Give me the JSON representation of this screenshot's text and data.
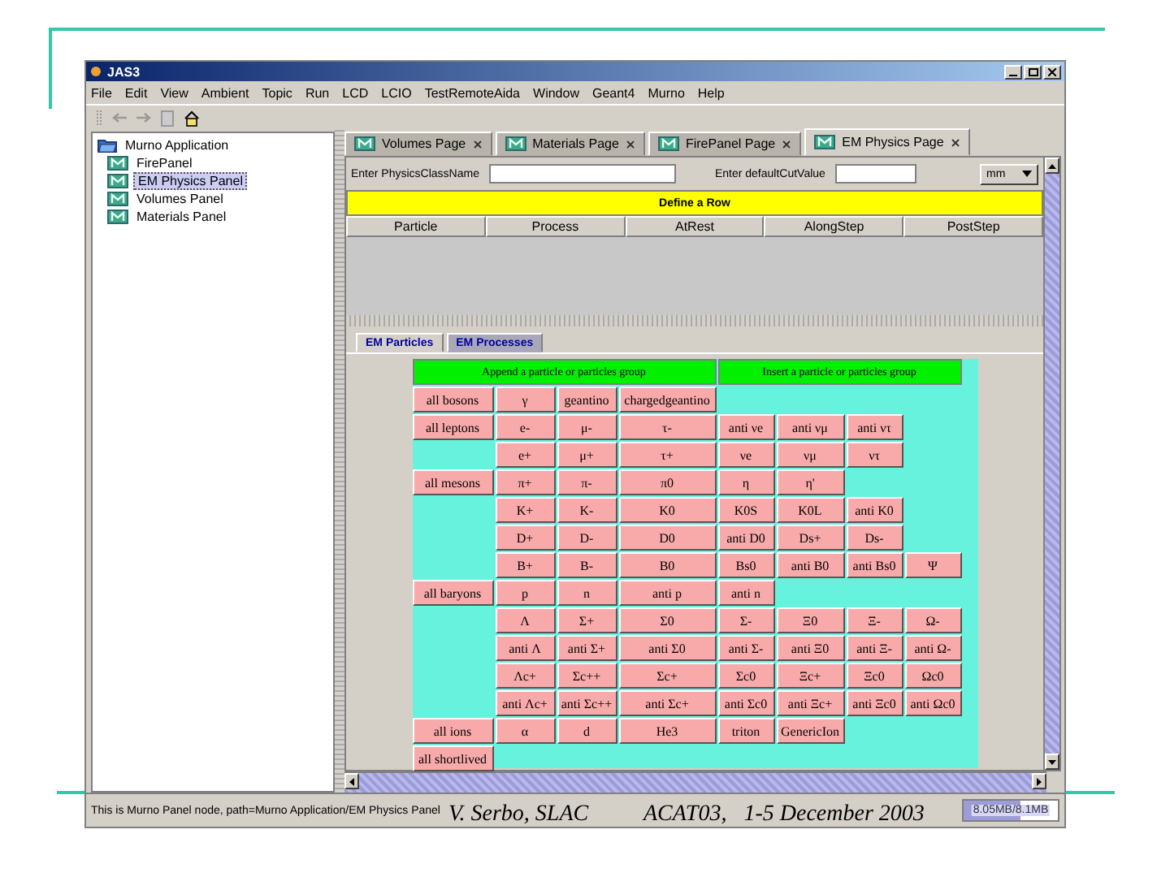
{
  "window": {
    "title": "JAS3"
  },
  "menu": [
    "File",
    "Edit",
    "View",
    "Ambient",
    "Topic",
    "Run",
    "LCD",
    "LCIO",
    "TestRemoteAida",
    "Window",
    "Geant4",
    "Murno",
    "Help"
  ],
  "tree": {
    "label": "Murno Application",
    "expanded": true,
    "children": [
      {
        "label": "FirePanel",
        "selected": false
      },
      {
        "label": "EM Physics Panel",
        "selected": true
      },
      {
        "label": "Volumes Panel",
        "selected": false
      },
      {
        "label": "Materials Panel",
        "selected": false
      }
    ]
  },
  "tabs": [
    {
      "label": "Volumes Page",
      "selected": false
    },
    {
      "label": "Materials Page",
      "selected": false
    },
    {
      "label": "FirePanel Page",
      "selected": false
    },
    {
      "label": "EM Physics Page",
      "selected": true
    }
  ],
  "form": {
    "class_label": "Enter PhysicsClassName",
    "cut_label": "Enter defaultCutValue",
    "unit": "mm"
  },
  "define_bar": "Define a Row",
  "columns": [
    "Particle",
    "Process",
    "AtRest",
    "AlongStep",
    "PostStep"
  ],
  "subtabs": [
    {
      "label": "EM Particles",
      "selected": true
    },
    {
      "label": "EM Processes",
      "selected": false
    }
  ],
  "actions": [
    "Append a particle or particles group",
    "Insert a particle or particles group"
  ],
  "particle_rows": [
    {
      "group": "all bosons",
      "cells": [
        "γ",
        "geantino",
        "chargedgeantino"
      ]
    },
    {
      "group": "all leptons",
      "cells": [
        "e-",
        "μ-",
        "τ-",
        "anti νe",
        "anti νμ",
        "anti ντ"
      ]
    },
    {
      "cells": [
        "e+",
        "μ+",
        "τ+",
        "νe",
        "νμ",
        "ντ"
      ]
    },
    {
      "group": "all mesons",
      "cells": [
        "π+",
        "π-",
        "π0",
        "η",
        "η'"
      ]
    },
    {
      "cells": [
        "K+",
        "K-",
        "K0",
        "K0S",
        "K0L",
        "anti K0"
      ]
    },
    {
      "cells": [
        "D+",
        "D-",
        "D0",
        "anti D0",
        "Ds+",
        "Ds-"
      ]
    },
    {
      "cells": [
        "B+",
        "B-",
        "B0",
        "Bs0",
        "anti B0",
        "anti Bs0",
        "Ψ"
      ]
    },
    {
      "group": "all baryons",
      "cells": [
        "p",
        "n",
        "anti p",
        "anti n"
      ]
    },
    {
      "cells": [
        "Λ",
        "Σ+",
        "Σ0",
        "Σ-",
        "Ξ0",
        "Ξ-",
        "Ω-"
      ]
    },
    {
      "cells": [
        "anti Λ",
        "anti Σ+",
        "anti Σ0",
        "anti Σ-",
        "anti Ξ0",
        "anti Ξ-",
        "anti Ω-"
      ]
    },
    {
      "cells": [
        "Λc+",
        "Σc++",
        "Σc+",
        "Σc0",
        "Ξc+",
        "Ξc0",
        "Ωc0"
      ]
    },
    {
      "cells": [
        "anti Λc+",
        "anti Σc++",
        "anti Σc+",
        "anti Σc0",
        "anti Ξc+",
        "anti Ξc0",
        "anti Ωc0"
      ]
    },
    {
      "group": "all ions",
      "cells": [
        "α",
        "d",
        "He3",
        "triton",
        "GenericIon"
      ]
    },
    {
      "group": "all shortlived",
      "cells": []
    }
  ],
  "status_bar": {
    "text": "This is Murno Panel node, path=Murno Application/EM Physics Panel",
    "memory": "8.05MB/8.1MB",
    "level": 0.6
  },
  "slide": {
    "author": "V. Serbo, SLAC",
    "event": "ACAT03,   1-5 December 2003"
  }
}
